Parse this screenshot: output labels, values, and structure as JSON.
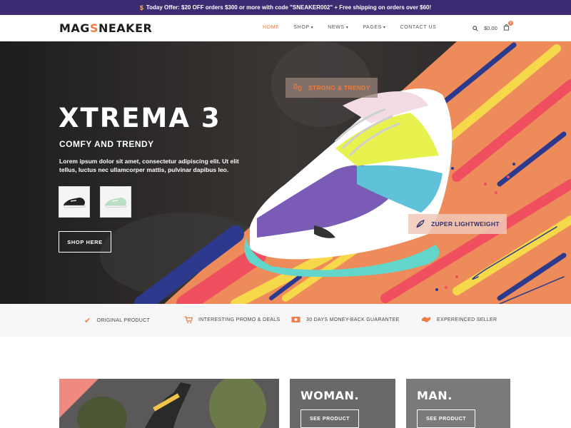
{
  "topbar": {
    "icon": "dollar-icon",
    "text": "Today Offer: $20 OFF orders $300 or more with code \"SNEAKER002\" + Free shipping on orders over $60!"
  },
  "header": {
    "logo_prefix": "MAG",
    "logo_accent": "S",
    "logo_suffix": "NEAKER",
    "nav": [
      {
        "label": "HOME",
        "active": true
      },
      {
        "label": "SHOP",
        "dropdown": true
      },
      {
        "label": "NEWS",
        "dropdown": true
      },
      {
        "label": "PAGES",
        "dropdown": true
      },
      {
        "label": "CONTACT US"
      }
    ],
    "cart_total": "$0.00",
    "cart_count": "0"
  },
  "hero": {
    "title": "XTREMA 3",
    "subtitle": "COMFY AND TRENDY",
    "description": "Lorem ipsum dolor sit amet, consectetur adipiscing elit. Ut elit tellus, luctus nec ullamcorper mattis, pulvinar dapibus leo.",
    "cta": "SHOP HERE",
    "tag1": "STRONG & TRENDY",
    "tag2": "ZUPER LIGHTWEIGHT"
  },
  "features": [
    {
      "icon": "check-icon",
      "label": "ORIGINAL PRODUCT"
    },
    {
      "icon": "cart-icon",
      "label": "INTERESTING PROMO & DEALS"
    },
    {
      "icon": "money-icon",
      "label": "30 DAYS MONEY-BACK GUARANTEE"
    },
    {
      "icon": "handshake-icon",
      "label": "EXPEREINCED SELLER"
    }
  ],
  "categories": {
    "woman_title": "WOMAN.",
    "woman_btn": "SEE PRODUCT",
    "man_title": "MAN.",
    "man_btn": "SEE PRODUCT"
  },
  "colors": {
    "accent": "#ec7d47",
    "banner": "#3c2a73"
  }
}
